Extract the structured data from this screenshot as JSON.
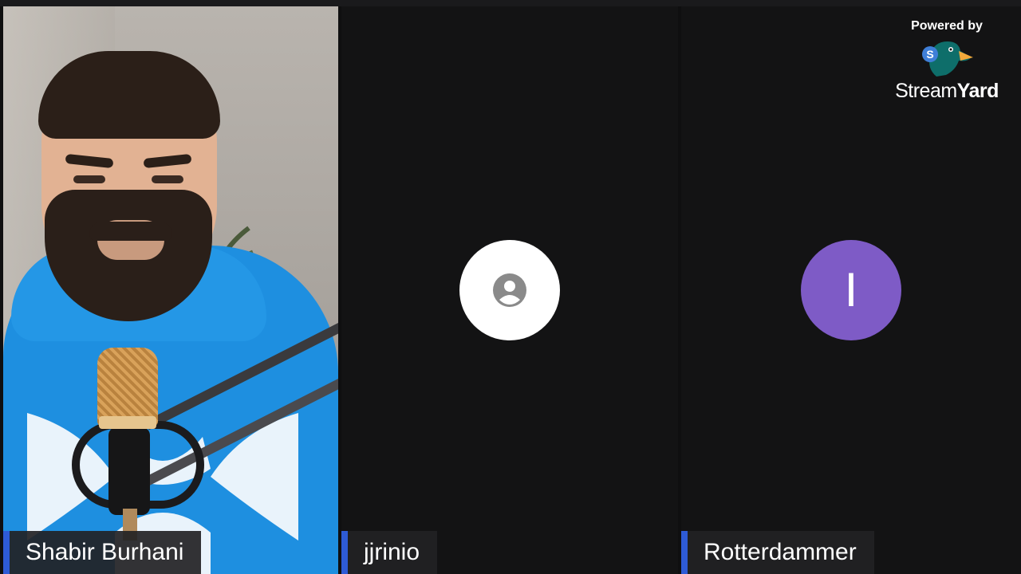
{
  "participants": [
    {
      "name": "Shabir Burhani",
      "video": "camera-on"
    },
    {
      "name": "jjrinio",
      "video": "camera-off",
      "avatar_icon": "user-icon"
    },
    {
      "name": "Rotterdammer",
      "video": "camera-off",
      "avatar_letter": "I"
    }
  ],
  "branding": {
    "powered_label": "Powered by",
    "wordmark_regular": "Stream",
    "wordmark_bold": "Yard",
    "logo_badge_letter": "S",
    "logo_icon": "duck-logo-icon"
  },
  "colors": {
    "nameplate_accent": "#2e5bd6",
    "avatar_purple": "#7e5bc6",
    "avatar_white": "#ffffff",
    "background": "#131314"
  }
}
